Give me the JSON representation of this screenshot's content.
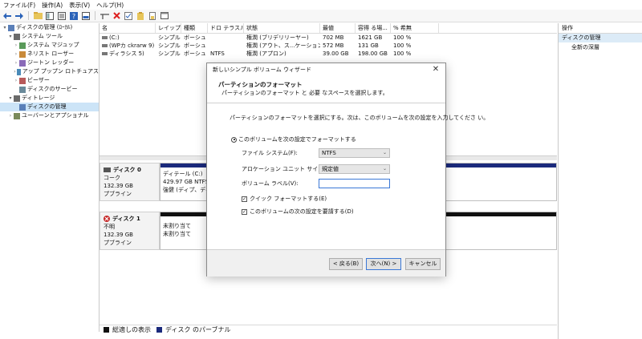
{
  "menu": [
    "ファイル(F)",
    "操作(A)",
    "表示(V)",
    "ヘルプ(H)"
  ],
  "tree": [
    {
      "label": "ディスクの管理 (ﾛｰｶﾙ)",
      "indent": 0,
      "twisty": "▾",
      "selected": false
    },
    {
      "label": "システム ツール",
      "indent": 1,
      "twisty": "▾",
      "selected": false
    },
    {
      "label": "システム マジュップ",
      "indent": 2,
      "twisty": "›",
      "selected": false
    },
    {
      "label": "ネリスト ローザー",
      "indent": 2,
      "twisty": "›",
      "selected": false
    },
    {
      "label": "ジートン レッダー",
      "indent": 2,
      "twisty": "›",
      "selected": false
    },
    {
      "label": "アップ プップン ロトチュアス",
      "indent": 2,
      "twisty": "›",
      "selected": false
    },
    {
      "label": "ビーザー",
      "indent": 2,
      "twisty": "›",
      "selected": false
    },
    {
      "label": "ディスクのサービー",
      "indent": 2,
      "twisty": "",
      "selected": false
    },
    {
      "label": "ディトレージ",
      "indent": 1,
      "twisty": "▾",
      "selected": false
    },
    {
      "label": "ディスクの管理",
      "indent": 2,
      "twisty": "",
      "selected": true
    },
    {
      "label": "ユーバーンとアプショナル",
      "indent": 1,
      "twisty": "›",
      "selected": false
    }
  ],
  "volume_table": {
    "headers": [
      "名",
      "レイップ",
      "種類",
      "ドロ テラスル",
      "状態",
      "最値",
      "容得 る場...",
      "% 希無"
    ],
    "rows": [
      [
        "(C:)",
        "シンプル",
        "ボーシュ",
        "",
        "権潤 (ブリデリリーヤー)",
        "702 MB",
        "1621 GB",
        "100 %"
      ],
      [
        "(WPカ ckrarw 9)",
        "シンプル",
        "ボーシュ",
        "",
        "権潤 (アウト、ス...ケーション)",
        "572 MB",
        "131 GB",
        "100 %"
      ],
      [
        "ディラシス 5)",
        "シンプル",
        "ボーシュ",
        "NTFS",
        "権潤 (アプロン)",
        "39.00 GB",
        "198.00 GB",
        "100 %"
      ]
    ]
  },
  "disks": {
    "disk0": {
      "name": "ディスク 0",
      "type": "コーク",
      "size": "132.39 GB",
      "status": "プブライン",
      "partition": {
        "title": "ディテール (C:)",
        "size": "429.97 GB NTFS",
        "status": "強健 (ディプ、ディ"
      }
    },
    "disk1": {
      "name": "ディスク 1",
      "type": "不明",
      "size": "132.39 GB",
      "status": "プブライン",
      "partition": {
        "line1": "未割り当て",
        "line2": "未割り当て"
      }
    }
  },
  "legend": [
    {
      "label": "総適しの表示",
      "color": "#111111"
    },
    {
      "label": "ディスク のパーブナル",
      "color": "#1b2a7c"
    }
  ],
  "actions": {
    "header": "操作",
    "section": "ディスクの管理",
    "item": "全新の深層"
  },
  "dialog": {
    "title": "新しいシンプル ボリューム ウィザード",
    "heading": "パーティションのフォーマット",
    "subheading": "パーティションのフォーマット と 必要 なスペースを選択します。",
    "description": "パーティションのフォーマットを選択にする。次は、このボリュームを次の設定を入力してくださ い。",
    "radio_label": "このボリュームを次の設定でフォーマットする",
    "fs_label": "ファイル システム(F):",
    "fs_value": "NTFS",
    "alloc_label": "アロケーション ユニット サイズ(F):",
    "alloc_value": "規定値",
    "vol_label_label": "ボリューム ラベル(V):",
    "vol_label_value": "",
    "quick_label": "クイック フォーマットする(E)",
    "compress_label": "このボリュームの次の設定を要請する(D)",
    "back_button": "< 戻る(B)",
    "next_button": "次へ(N) >",
    "cancel_button": "キャンセル"
  },
  "colors": {
    "primary_partition_bar": "#1b2a7c",
    "unallocated_bar": "#111111",
    "accent": "#3b78d6",
    "selection": "#cce4f7"
  }
}
